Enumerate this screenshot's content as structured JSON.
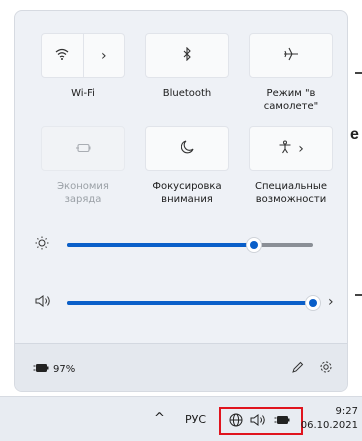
{
  "background": {
    "fragment_text": "e"
  },
  "quick_settings": {
    "tiles": [
      {
        "id": "wifi",
        "label": "Wi-Fi",
        "icon": "wifi-icon",
        "expand_icon": "chevron-right-icon"
      },
      {
        "id": "bluetooth",
        "label": "Bluetooth",
        "icon": "bluetooth-icon"
      },
      {
        "id": "airplane",
        "label": "Режим \"в самолете\"",
        "icon": "airplane-icon"
      },
      {
        "id": "battery_saver",
        "label": "Экономия заряда",
        "icon": "battery-saver-icon",
        "state": "disabled"
      },
      {
        "id": "focus",
        "label": "Фокусировка внимания",
        "icon": "moon-icon"
      },
      {
        "id": "accessibility",
        "label": "Специальные возможности",
        "icon": "accessibility-icon",
        "expand_icon": "chevron-right-icon"
      }
    ],
    "brightness": {
      "icon": "sun-icon",
      "level_percent": 76
    },
    "volume": {
      "icon": "speaker-icon",
      "level_percent": 100,
      "expand_icon": "chevron-right-icon"
    },
    "battery_label": "97%",
    "footer": {
      "edit_icon": "pencil-icon",
      "settings_icon": "gear-icon"
    }
  },
  "taskbar": {
    "overflow_icon": "chevron-up-icon",
    "language": "РУС",
    "tray_icons": [
      "globe-icon",
      "speaker-icon",
      "battery-icon"
    ],
    "time": "9:27",
    "date": "06.10.2021",
    "highlight_color": "#e0141e"
  },
  "colors": {
    "accent": "#0a5fc9"
  }
}
